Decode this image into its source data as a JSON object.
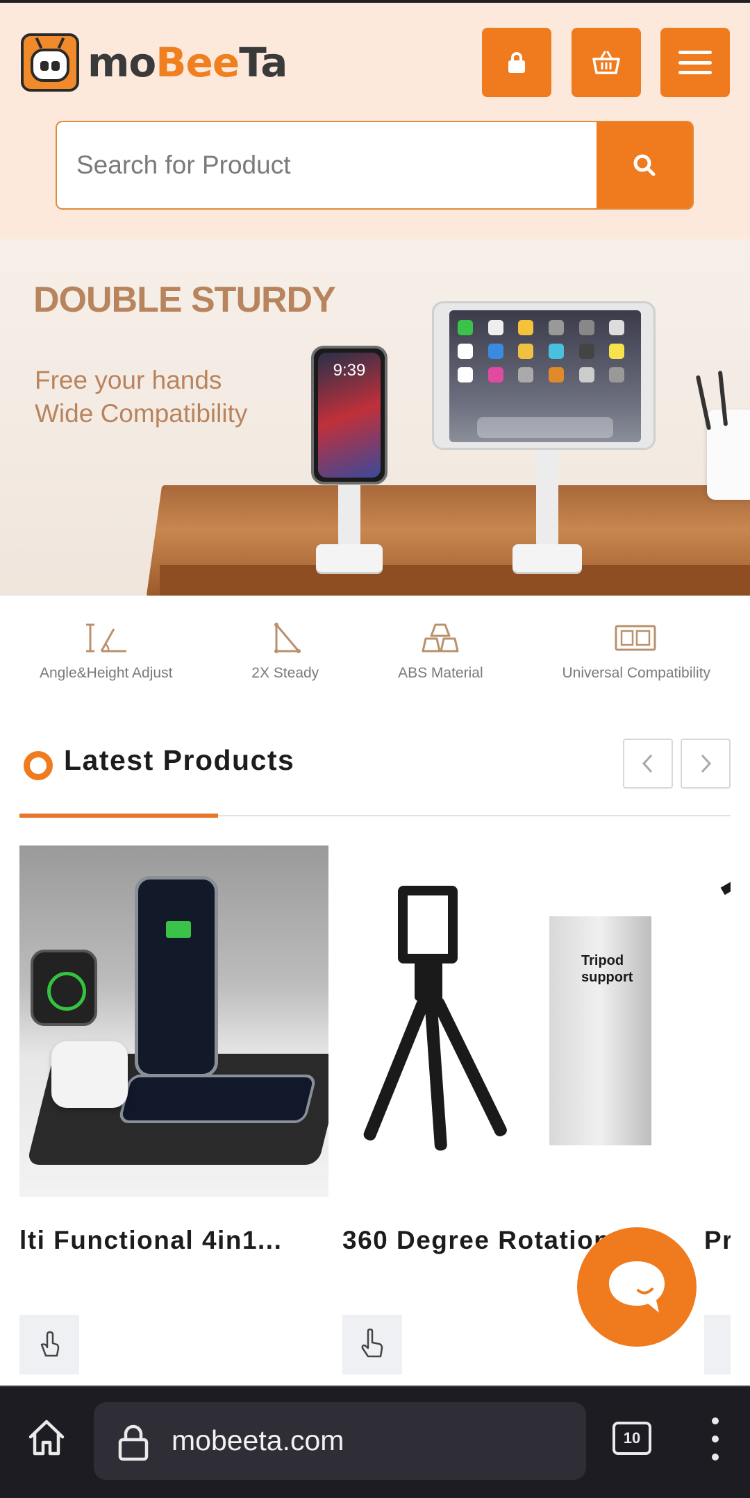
{
  "header": {
    "logo_text_prefix": "mo",
    "logo_text_accent": "Bee",
    "logo_text_suffix": "Ta",
    "accent_color": "#f07a1e",
    "buttons": [
      {
        "name": "account",
        "icon": "lock-icon"
      },
      {
        "name": "cart",
        "icon": "basket-icon"
      },
      {
        "name": "menu",
        "icon": "hamburger-icon"
      }
    ]
  },
  "search": {
    "placeholder": "Search for Product",
    "value": "",
    "button_icon": "search-icon"
  },
  "banner": {
    "title": "DOUBLE STURDY",
    "subtitle": "Free your hands\nWide Compatibility",
    "phone_time": "9:39"
  },
  "features": [
    {
      "label": "Angle&Height Adjust",
      "icon": "angle-height-icon"
    },
    {
      "label": "2X Steady",
      "icon": "triangle-icon"
    },
    {
      "label": "ABS Material",
      "icon": "blocks-icon"
    },
    {
      "label": "Universal Compatibility",
      "icon": "devices-icon"
    }
  ],
  "latest": {
    "title": "Latest Products",
    "prev_icon": "chevron-left-icon",
    "next_icon": "chevron-right-icon"
  },
  "products": [
    {
      "name": "lti Functional 4in1...",
      "action_icon": "hand-pointer-icon"
    },
    {
      "name": "360 Degree Rotation",
      "box_text": "Tripod\n  support",
      "action_icon": "hand-pointer-icon"
    },
    {
      "name": "Pr",
      "action_icon": "hand-pointer-icon"
    }
  ],
  "chat": {
    "icon": "chat-bubble-icon"
  },
  "browser": {
    "url": "mobeeta.com",
    "tab_count": "10",
    "home_icon": "home-icon",
    "lock_icon": "lock-icon",
    "more_icon": "more-vertical-icon"
  }
}
